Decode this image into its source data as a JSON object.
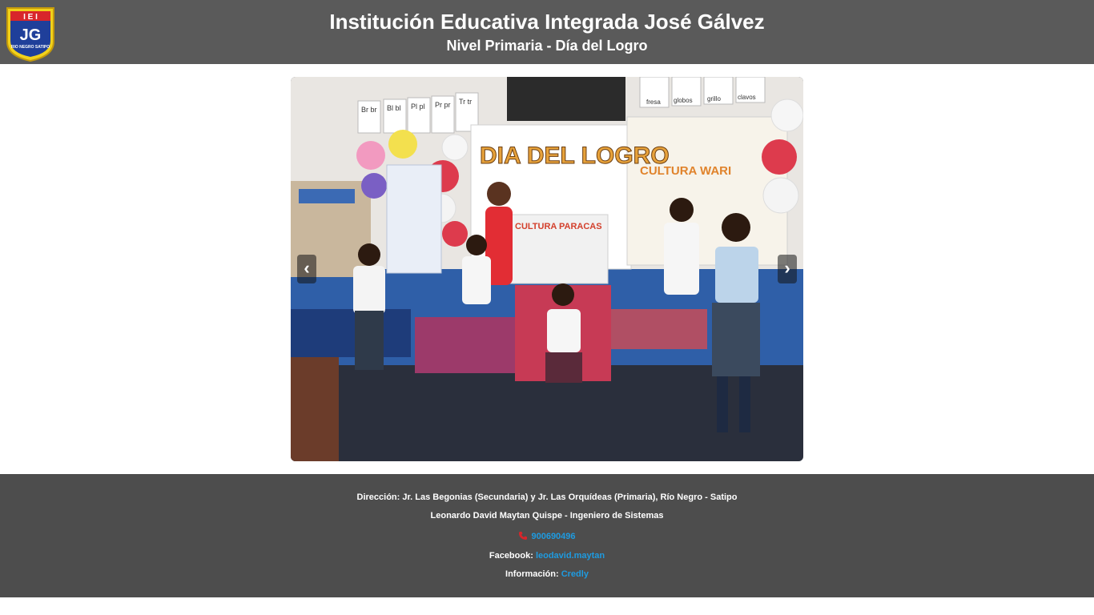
{
  "header": {
    "logo_text": "JG",
    "logo_top_letters": "I E I",
    "logo_bottom_text": "RIO NEGRO SATIPO",
    "title": "Institución Educativa Integrada José Gálvez",
    "subtitle": "Nivel Primaria - Día del Logro"
  },
  "carousel": {
    "prev_label": "‹",
    "next_label": "›",
    "banner_text": "DIA DEL LOGRO",
    "sign_wari": "CULTURA WARI",
    "sign_paracas": "CULTURA PARACAS",
    "alphabet_cards": [
      "Br br",
      "Bl bl",
      "Pl pl",
      "Pr pr",
      "Tr tr"
    ],
    "top_words": [
      "fresa",
      "globos",
      "grillo",
      "clavos"
    ]
  },
  "footer": {
    "address": "Dirección: Jr. Las Begonias (Secundaria) y Jr. Las Orquídeas (Primaria), Río Negro - Satipo",
    "author": "Leonardo David Maytan Quispe - Ingeniero de Sistemas",
    "phone": "900690496",
    "facebook_label": "Facebook: ",
    "facebook_link": "leodavid.maytan",
    "info_label": "Información: ",
    "info_link": "Credly"
  }
}
